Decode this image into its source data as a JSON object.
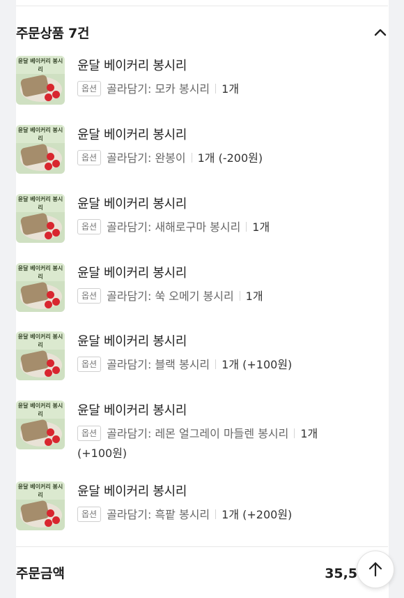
{
  "order": {
    "section_title": "주문상품 7건",
    "option_badge": "옵션",
    "items": [
      {
        "name": "윤달 베이커리 봉시리",
        "option": "골라담기: 모카 봉시리",
        "qty": "1개"
      },
      {
        "name": "윤달 베이커리 봉시리",
        "option": "골라담기: 완봉이",
        "qty": "1개 (-200원)"
      },
      {
        "name": "윤달 베이커리 봉시리",
        "option": "골라담기: 새해로구마 봉시리",
        "qty": "1개"
      },
      {
        "name": "윤달 베이커리 봉시리",
        "option": "골라담기: 쑥 오메기 봉시리",
        "qty": "1개"
      },
      {
        "name": "윤달 베이커리 봉시리",
        "option": "골라담기: 블랙 봉시리",
        "qty": "1개 (+100원)"
      },
      {
        "name": "윤달 베이커리 봉시리",
        "option": "골라담기: 레몬 얼그레이 마들렌 봉시리",
        "qty": "1개",
        "qty_extra": "(+100원)"
      },
      {
        "name": "윤달 베이커리 봉시리",
        "option": "골라담기: 흑팥 봉시리",
        "qty": "1개 (+200원)"
      }
    ],
    "thumbnail_text": "윤달 베이커리 봉시리",
    "total_label": "주문금액",
    "total_value": "35,550원"
  },
  "icons": {
    "collapse": "chevron-up-icon",
    "scroll_top": "arrow-up-icon"
  },
  "colors": {
    "accent_text": "#1f1f1f",
    "muted_text": "#666666",
    "background": "#f1f2f4"
  }
}
